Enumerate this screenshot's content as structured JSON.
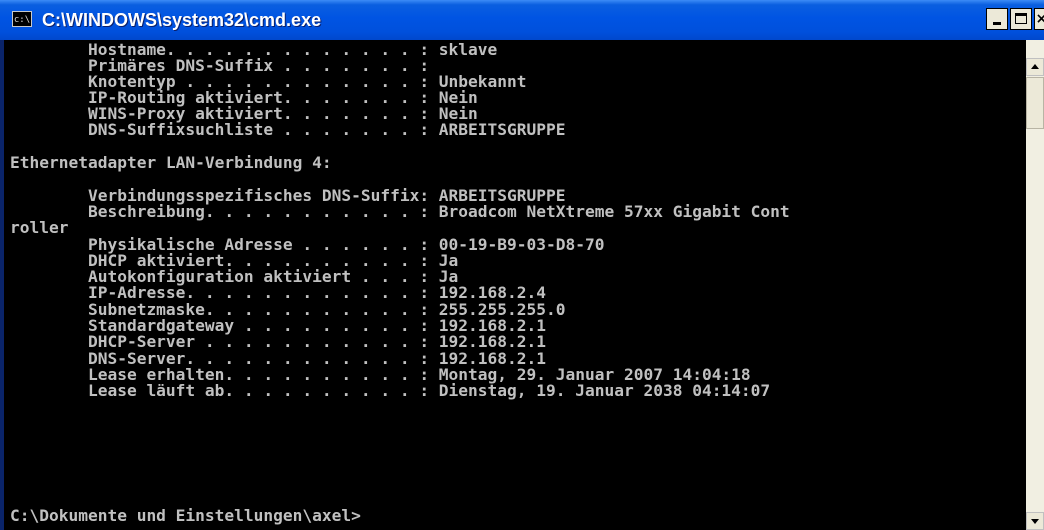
{
  "window": {
    "title": "C:\\WINDOWS\\system32\\cmd.exe",
    "icon_label": "c:\\",
    "colors": {
      "titlebar": "#0054e3",
      "console_background": "#000000",
      "console_text": "#c0c0c0"
    }
  },
  "buttons": {
    "minimize_icon": "minimize-icon",
    "maximize_icon": "maximize-icon",
    "close_label": "×"
  },
  "console": {
    "lines": [
      "        Hostname. . . . . . . . . . . . . : sklave",
      "        Primäres DNS-Suffix . . . . . . . :",
      "        Knotentyp . . . . . . . . . . . . : Unbekannt",
      "        IP-Routing aktiviert. . . . . . . : Nein",
      "        WINS-Proxy aktiviert. . . . . . . : Nein",
      "        DNS-Suffixsuchliste . . . . . . . : ARBEITSGRUPPE",
      "",
      "Ethernetadapter LAN-Verbindung 4:",
      "",
      "        Verbindungsspezifisches DNS-Suffix: ARBEITSGRUPPE",
      "        Beschreibung. . . . . . . . . . . : Broadcom NetXtreme 57xx Gigabit Cont",
      "roller",
      "        Physikalische Adresse . . . . . . : 00-19-B9-03-D8-70",
      "        DHCP aktiviert. . . . . . . . . . : Ja",
      "        Autokonfiguration aktiviert . . . : Ja",
      "        IP-Adresse. . . . . . . . . . . . : 192.168.2.4",
      "        Subnetzmaske. . . . . . . . . . . : 255.255.255.0",
      "        Standardgateway . . . . . . . . . : 192.168.2.1",
      "        DHCP-Server . . . . . . . . . . . : 192.168.2.1",
      "        DNS-Server. . . . . . . . . . . . : 192.168.2.1",
      "        Lease erhalten. . . . . . . . . . : Montag, 29. Januar 2007 14:04:18",
      "        Lease läuft ab. . . . . . . . . . : Dienstag, 19. Januar 2038 04:14:07",
      "",
      "C:\\Dokumente und Einstellungen\\axel>"
    ]
  }
}
